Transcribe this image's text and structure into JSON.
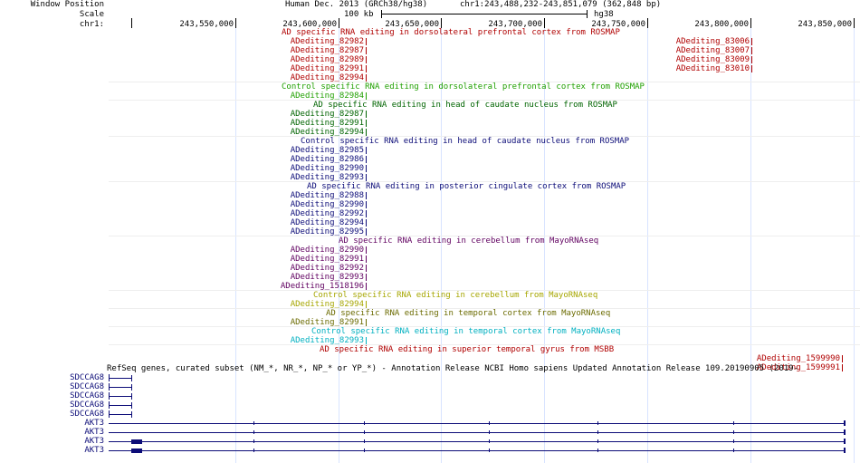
{
  "header": {
    "window_position_label": "Window Position",
    "scale_label": "Scale",
    "chrom_label": "chr1:",
    "assembly": "Human Dec. 2013 (GRCh38/hg38)",
    "coords": "chr1:243,488,232-243,851,079 (362,848 bp)",
    "scale_value": "100 kb",
    "scale_assembly": "hg38",
    "ticks": [
      "243,550,000",
      "243,600,000",
      "243,650,000",
      "243,700,000",
      "243,750,000",
      "243,800,000",
      "243,850,000"
    ]
  },
  "colors": {
    "red": "#b00000",
    "green": "#20a000",
    "darkgreen": "#006400",
    "navy": "#0c0c78",
    "purple": "#600060",
    "olive": "#a6a600",
    "darkolive": "#6b6b00",
    "teal": "#00b0c0"
  },
  "tracks": [
    {
      "title": "AD specific RNA editing in dorsolateral prefrontal cortex from ROSMAP",
      "color": "red",
      "items": [
        "ADediting_82982",
        "ADediting_82987",
        "ADediting_82989",
        "ADediting_82991",
        "ADediting_82994"
      ],
      "right_items": [
        "ADediting_83006",
        "ADediting_83007",
        "ADediting_83009",
        "ADediting_83010"
      ]
    },
    {
      "title": "Control specific RNA editing in dorsolateral prefrontal cortex from ROSMAP",
      "color": "green",
      "items": [
        "ADediting_82984"
      ]
    },
    {
      "title": "AD specific RNA editing in head of caudate nucleus from ROSMAP",
      "color": "darkgreen",
      "items": [
        "ADediting_82987",
        "ADediting_82991",
        "ADediting_82994"
      ]
    },
    {
      "title": "Control specific RNA editing in head of caudate nucleus from ROSMAP",
      "color": "navy",
      "items": [
        "ADediting_82985",
        "ADediting_82986",
        "ADediting_82990",
        "ADediting_82993"
      ]
    },
    {
      "title": "AD specific RNA editing in posterior cingulate cortex from ROSMAP",
      "color": "navy",
      "items": [
        "ADediting_82988",
        "ADediting_82990",
        "ADediting_82992",
        "ADediting_82994",
        "ADediting_82995"
      ]
    },
    {
      "title": "AD specific RNA editing in cerebellum from MayoRNAseq",
      "color": "purple",
      "items": [
        "ADediting_82990",
        "ADediting_82991",
        "ADediting_82992",
        "ADediting_82993",
        "ADediting_1518196"
      ]
    },
    {
      "title": "Control specific RNA editing in cerebellum from MayoRNAseq",
      "color": "olive",
      "items": [
        "ADediting_82994"
      ]
    },
    {
      "title": "AD specific RNA editing in temporal cortex from MayoRNAseq",
      "color": "darkolive",
      "items": [
        "ADediting_82991"
      ]
    },
    {
      "title": "Control specific RNA editing in temporal cortex from MayoRNAseq",
      "color": "teal",
      "items": [
        "ADediting_82993"
      ]
    },
    {
      "title": "AD specific RNA editing in superior temporal gyrus from MSBB",
      "color": "red",
      "items": [],
      "right_items": [
        "ADediting_1599990",
        "ADediting_1599991"
      ]
    }
  ],
  "refseq": {
    "title": "RefSeq genes, curated subset (NM_*, NR_*, NP_* or YP_*) - Annotation Release NCBI Homo sapiens Updated Annotation Release 109.20190905 (2019-",
    "genes": [
      "SDCCAG8",
      "SDCCAG8",
      "SDCCAG8",
      "SDCCAG8",
      "SDCCAG8",
      "AKT3",
      "AKT3",
      "AKT3",
      "AKT3"
    ]
  }
}
